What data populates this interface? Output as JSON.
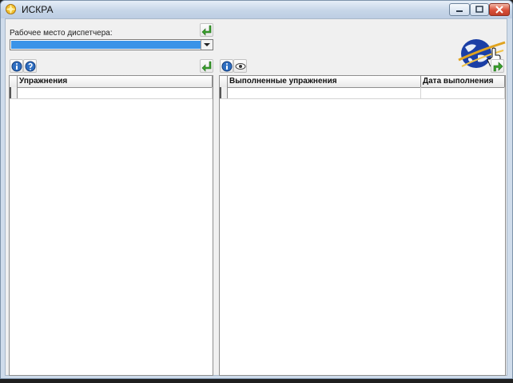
{
  "window": {
    "title": "ИСКРА"
  },
  "dispatcher": {
    "label": "Рабочее место диспетчера:",
    "selected_value": ""
  },
  "left_panel": {
    "columns": [
      "Упражнения"
    ],
    "rows": [
      ""
    ]
  },
  "right_panel": {
    "columns": [
      "Выполненные упражнения",
      "Дата выполнения"
    ],
    "rows": [
      [
        "",
        ""
      ]
    ]
  },
  "colors": {
    "selection": "#3a93e8",
    "accent_green": "#3aa12d",
    "info_blue": "#2f6fc2"
  },
  "icons": [
    "app-icon",
    "minimize-icon",
    "maximize-icon",
    "close-icon",
    "green-arrow-icon",
    "info-icon",
    "help-icon",
    "eye-icon",
    "globe-logo",
    "hand-cursor-icon"
  ]
}
